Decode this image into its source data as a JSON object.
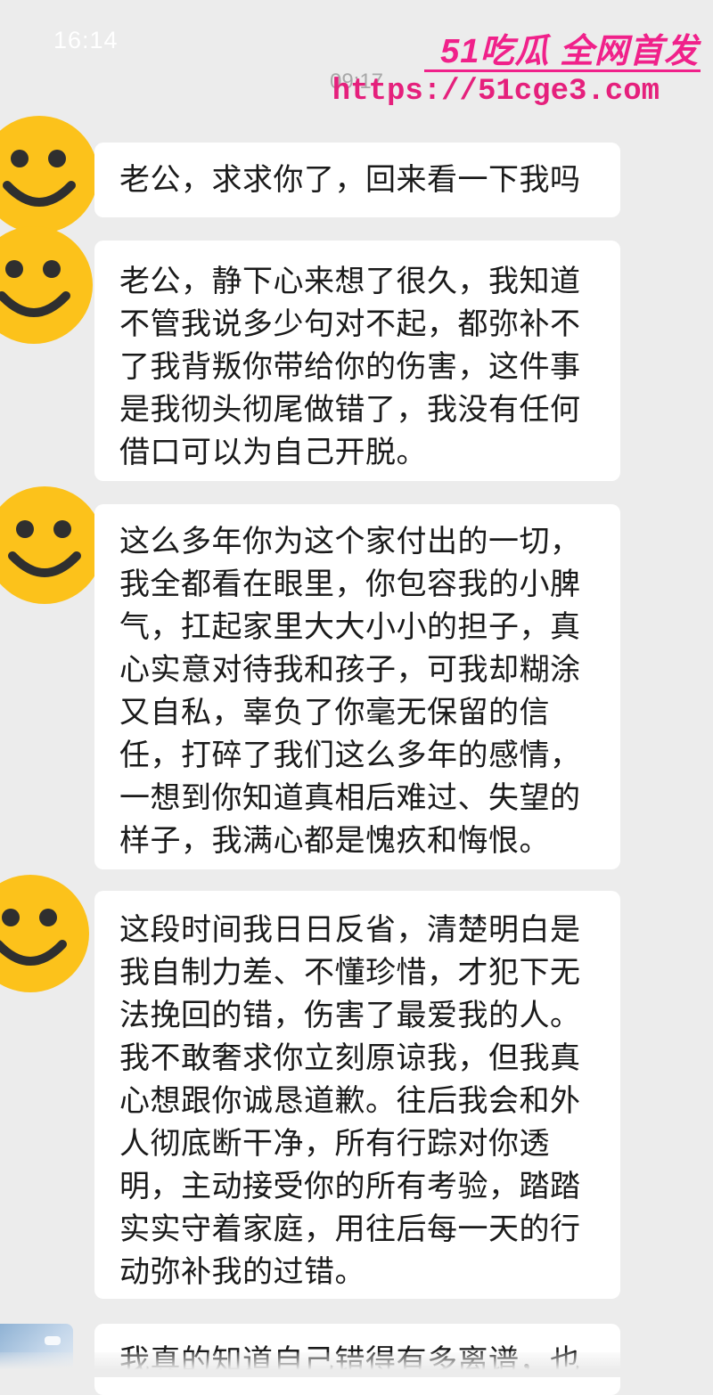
{
  "status_bar": {
    "time": "16:14"
  },
  "chat": {
    "timestamp": "09:17",
    "messages": [
      {
        "text": "老公，求求你了，回来看一下我吗"
      },
      {
        "text": "老公，静下心来想了很久，我知道\n不管我说多少句对不起，都弥补不\n了我背叛你带给你的伤害，这件事\n是我彻头彻尾做错了，我没有任何\n借口可以为自己开脱。"
      },
      {
        "text": "这么多年你为这个家付出的一切，\n我全都看在眼里，你包容我的小脾\n气，扛起家里大大小小的担子，真\n心实意对待我和孩子，可我却糊涂\n又自私，辜负了你毫无保留的信\n任，打碎了我们这么多年的感情，\n一想到你知道真相后难过、失望的\n样子，我满心都是愧疚和悔恨。"
      },
      {
        "text": "这段时间我日日反省，清楚明白是\n我自制力差、不懂珍惜，才犯下无\n法挽回的错，伤害了最爱我的人。\n我不敢奢求你立刻原谅我，但我真\n心想跟你诚恳道歉。往后我会和外\n人彻底断干净，所有行踪对你透\n明，主动接受你的所有考验，踏踏\n实实守着家庭，用往后每一天的行\n动弥补我的过错。"
      },
      {
        "text": "我真的知道自己错得有多离谱，也"
      }
    ]
  },
  "watermark": {
    "brand": "51吃瓜 全网首发",
    "url": "https://51cge3.com"
  },
  "colors": {
    "background": "#ececec",
    "bubble": "#ffffff",
    "text": "#1a1a1a",
    "timestamp": "#a8a8a8",
    "watermark": "#f0218a",
    "emoji_face": "#fcc21b"
  },
  "icons": {
    "avatar": "smiley-face-icon"
  }
}
